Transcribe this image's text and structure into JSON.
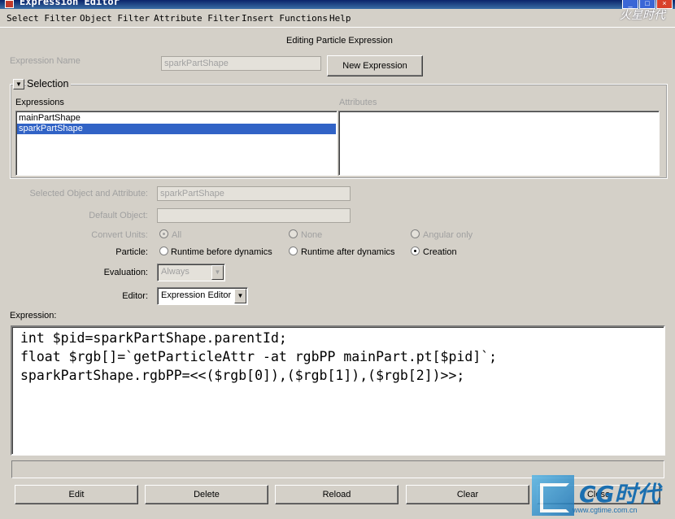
{
  "window": {
    "title": "Expression Editor"
  },
  "watermark_top": "火星时代",
  "menu": [
    "Select Filter",
    "Object Filter",
    "Attribute Filter",
    "Insert Functions",
    "Help"
  ],
  "header": {
    "title": "Editing Particle Expression"
  },
  "expression_name": {
    "label": "Expression Name",
    "value": "sparkPartShape"
  },
  "new_expression_button": "New Expression",
  "selection": {
    "title": "Selection",
    "expressions_label": "Expressions",
    "attributes_label": "Attributes",
    "expressions": [
      "mainPartShape",
      "sparkPartShape"
    ],
    "selected_index": 1
  },
  "form": {
    "selected_object_label": "Selected Object and Attribute:",
    "selected_object_value": "sparkPartShape",
    "default_object_label": "Default Object:",
    "default_object_value": "",
    "convert_units_label": "Convert Units:",
    "convert_units_options": [
      "All",
      "None",
      "Angular only"
    ],
    "particle_label": "Particle:",
    "particle_options": [
      "Runtime before dynamics",
      "Runtime after dynamics",
      "Creation"
    ],
    "particle_selected": "Creation",
    "evaluation_label": "Evaluation:",
    "evaluation_value": "Always",
    "editor_label": "Editor:",
    "editor_value": "Expression Editor"
  },
  "expression": {
    "label": "Expression:",
    "lines": [
      "int $pid=sparkPartShape.parentId;",
      "float $rgb[]=`getParticleAttr -at rgbPP mainPart.pt[$pid]`;",
      "sparkPartShape.rgbPP=<<($rgb[0]),($rgb[1]),($rgb[2])>>;"
    ]
  },
  "buttons": {
    "edit": "Edit",
    "delete": "Delete",
    "reload": "Reload",
    "clear": "Clear",
    "close": "Close"
  },
  "watermark": {
    "brand": "CG时代",
    "url": "www.cgtime.com.cn"
  }
}
